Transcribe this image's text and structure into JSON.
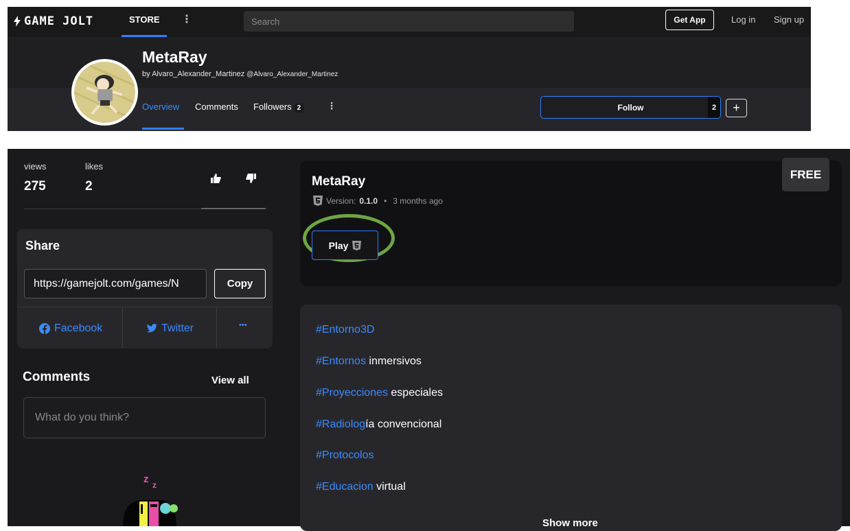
{
  "topbar": {
    "logo_text": "GAME JOLT",
    "store_label": "STORE",
    "search_placeholder": "Search",
    "get_app_label": "Get App",
    "login_label": "Log in",
    "signup_label": "Sign up"
  },
  "profile": {
    "title": "MetaRay",
    "by_prefix": "by",
    "author": "Alvaro_Alexander_Martinez",
    "author_handle": "@Alvaro_Alexander_Martinez",
    "tabs": [
      {
        "label": "Overview",
        "active": true
      },
      {
        "label": "Comments"
      },
      {
        "label": "Followers",
        "badge": "2"
      }
    ],
    "follow_label": "Follow",
    "follow_count": "2",
    "plus_label": "+"
  },
  "stats": {
    "views_label": "views",
    "views_value": "275",
    "likes_label": "likes",
    "likes_value": "2"
  },
  "share": {
    "heading": "Share",
    "url": "https://gamejolt.com/games/N",
    "copy_label": "Copy",
    "facebook_label": "Facebook",
    "twitter_label": "Twitter",
    "more_label": "•••"
  },
  "comments": {
    "heading": "Comments",
    "view_all_label": "View all",
    "input_placeholder": "What do you think?"
  },
  "game_card": {
    "price_badge": "FREE",
    "title": "MetaRay",
    "version_label": "Version:",
    "version_value": "0.1.0",
    "separator": "•",
    "time_ago": "3 months ago",
    "play_label": "Play"
  },
  "description": {
    "lines": [
      {
        "tag": "#Entorno3D",
        "rest": ""
      },
      {
        "tag": "#Entornos",
        "rest": " inmersivos"
      },
      {
        "tag": "#Proyecciones",
        "rest": " especiales"
      },
      {
        "tag": "#Radiolog",
        "rest": "ía convencional"
      },
      {
        "tag": "#Protocolos",
        "rest": ""
      },
      {
        "tag": "#Educacion",
        "rest": " virtual"
      }
    ],
    "show_more_label": "Show more"
  },
  "colors": {
    "accent_blue": "#2f7fff",
    "link_blue": "#3b8bff",
    "highlight_green": "#6ea642",
    "panel_dark": "#27272b",
    "page_dark": "#1a1a1c"
  }
}
